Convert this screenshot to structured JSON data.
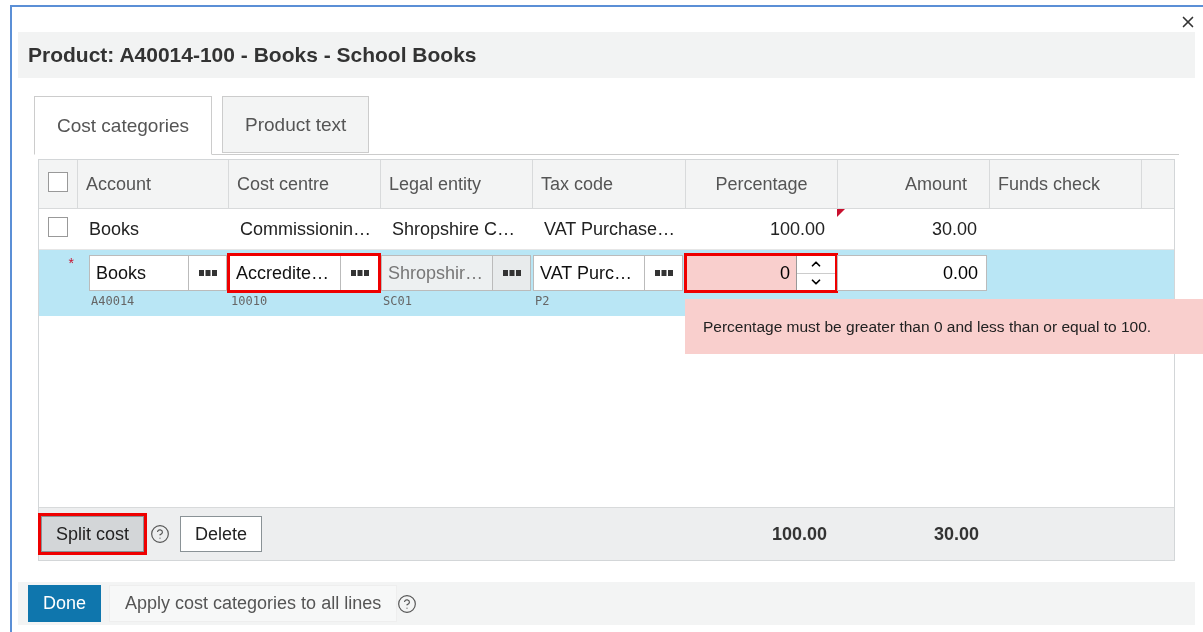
{
  "dialog": {
    "title": "Product: A40014-100 - Books - School Books"
  },
  "tabs": [
    {
      "label": "Cost categories",
      "selected": true
    },
    {
      "label": "Product text",
      "selected": false
    }
  ],
  "grid": {
    "all_checked": false,
    "columns": [
      "Account",
      "Cost centre",
      "Legal entity",
      "Tax code",
      "Percentage",
      "Amount",
      "Funds check"
    ],
    "rows": [
      {
        "checked": false,
        "cells": [
          "Books",
          "Commissionin…",
          "Shropshire C…",
          "VAT Purchase…",
          "100.00",
          "30.00"
        ],
        "flagged": true
      }
    ],
    "edit_row": {
      "required_mark": "*",
      "lookups": [
        {
          "value": "Books",
          "code": "A40014",
          "disabled": false,
          "highlighted": false
        },
        {
          "value": "Accredite…",
          "code": "10010",
          "disabled": false,
          "highlighted": true
        },
        {
          "value": "Shropshir…",
          "code": "SC01",
          "disabled": true,
          "highlighted": false
        },
        {
          "value": "VAT Purc…",
          "code": "P2",
          "disabled": false,
          "highlighted": false
        }
      ],
      "percentage": {
        "value": "0",
        "invalid": true,
        "highlighted": true
      },
      "amount": "0.00"
    },
    "error_message": "Percentage must be greater than 0 and less than or equal to 100.",
    "buttons": [
      {
        "kind": "button",
        "label": "Split cost",
        "highlighted": true
      },
      {
        "kind": "help"
      },
      {
        "kind": "button",
        "label": "Delete",
        "highlighted": false
      }
    ],
    "totals": [
      "100.00",
      "30.00"
    ]
  },
  "actions": [
    {
      "label": "Done",
      "kind": "primary"
    },
    {
      "label": "Apply cost categories to all lines",
      "kind": "secondary"
    },
    {
      "kind": "help"
    }
  ]
}
